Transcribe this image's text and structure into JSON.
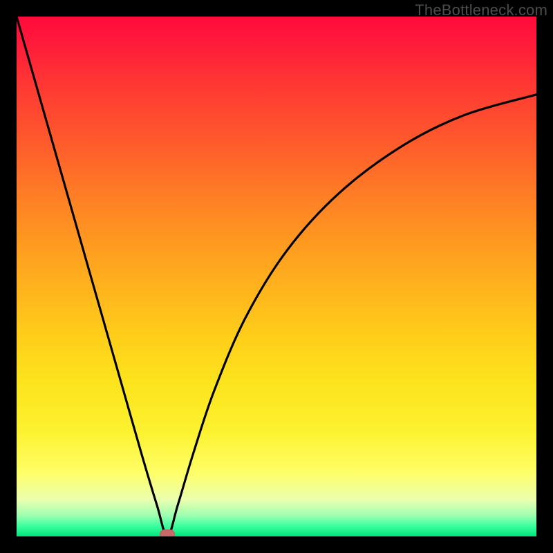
{
  "watermark": "TheBottleneck.com",
  "colors": {
    "curve": "#000000",
    "dot": "#c86a6a",
    "frame": "#000000"
  },
  "chart_data": {
    "type": "line",
    "title": "",
    "xlabel": "",
    "ylabel": "",
    "xlim": [
      0,
      100
    ],
    "ylim": [
      0,
      100
    ],
    "grid": false,
    "legend": false,
    "notes": "V-shaped bottleneck curve on red-to-green vertical gradient. Axes unlabeled. Left branch descends steeply from top-left to a minimum near x≈29, y≈0; right branch rises with diminishing slope toward upper-right, ending near x=100, y≈85. A small rounded marker sits at the minimum.",
    "minimum_marker": {
      "x": 29,
      "y": 0
    },
    "series": [
      {
        "name": "bottleneck-curve",
        "x": [
          0,
          4,
          8,
          12,
          16,
          20,
          24,
          27,
          29,
          31,
          34,
          38,
          44,
          52,
          62,
          74,
          86,
          100
        ],
        "y": [
          100,
          86,
          72,
          58,
          44,
          30,
          16,
          6,
          0,
          6,
          16,
          28,
          42,
          55,
          66,
          75,
          81,
          85
        ]
      }
    ]
  }
}
